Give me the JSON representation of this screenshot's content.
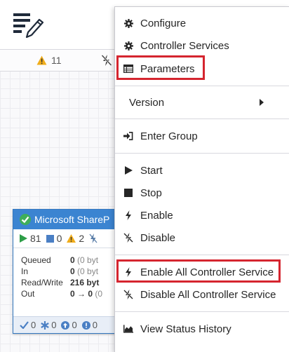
{
  "toolbar": {
    "warning_count": "11"
  },
  "process_group": {
    "title": "Microsoft ShareP",
    "stats": {
      "running": "81",
      "stopped": "0",
      "invalid": "2"
    },
    "rows": [
      {
        "label": "Queued",
        "value": "0",
        "detail": " (0 byt"
      },
      {
        "label": "In",
        "value": "0",
        "detail": " (0 byt"
      },
      {
        "label": "Read/Write",
        "value": "216 byt",
        "detail": ""
      },
      {
        "label": "Out",
        "value": "0 → 0",
        "detail": " (0"
      }
    ],
    "footer": {
      "up_to_date": "0",
      "locally_modified": "0",
      "stale": "0",
      "sync_failure": "0"
    }
  },
  "context_menu": {
    "items": [
      {
        "label": "Configure",
        "icon": "gear-icon"
      },
      {
        "label": "Controller Services",
        "icon": "gear-icon"
      },
      {
        "label": "Parameters",
        "icon": "table-icon"
      },
      {
        "label": "Version",
        "icon": "",
        "submenu": true
      },
      {
        "label": "Enter Group",
        "icon": "sign-in-icon"
      },
      {
        "label": "Start",
        "icon": "play-icon"
      },
      {
        "label": "Stop",
        "icon": "stop-icon"
      },
      {
        "label": "Enable",
        "icon": "bolt-icon"
      },
      {
        "label": "Disable",
        "icon": "bolt-slash-icon"
      },
      {
        "label": "Enable All Controller Service",
        "icon": "bolt-icon"
      },
      {
        "label": "Disable All Controller Service",
        "icon": "bolt-slash-icon"
      },
      {
        "label": "View Status History",
        "icon": "area-chart-icon"
      }
    ],
    "highlight_color": "#d5252f"
  }
}
